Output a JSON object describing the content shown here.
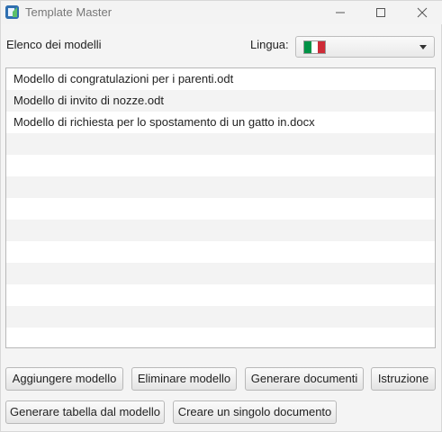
{
  "window": {
    "title": "Template Master",
    "icon": "template-master-app-icon"
  },
  "header": {
    "list_label": "Elenco dei modelli",
    "language_label": "Lingua:"
  },
  "language_select": {
    "selected": "Italiano",
    "flag_colors": [
      "#009246",
      "#ffffff",
      "#ce2b37"
    ]
  },
  "templates": {
    "items": [
      "Modello di congratulazioni per i parenti.odt",
      "Modello di invito di nozze.odt",
      "Modello di richiesta per lo spostamento di un gatto in.docx",
      "",
      "",
      "",
      "",
      "",
      "",
      "",
      "",
      "",
      ""
    ]
  },
  "buttons": {
    "add": "Aggiungere modello",
    "remove": "Eliminare modello",
    "generate_docs": "Generare documenti",
    "instructions": "Istruzione",
    "generate_table": "Generare tabella dal modello",
    "create_single": "Creare un singolo documento"
  }
}
